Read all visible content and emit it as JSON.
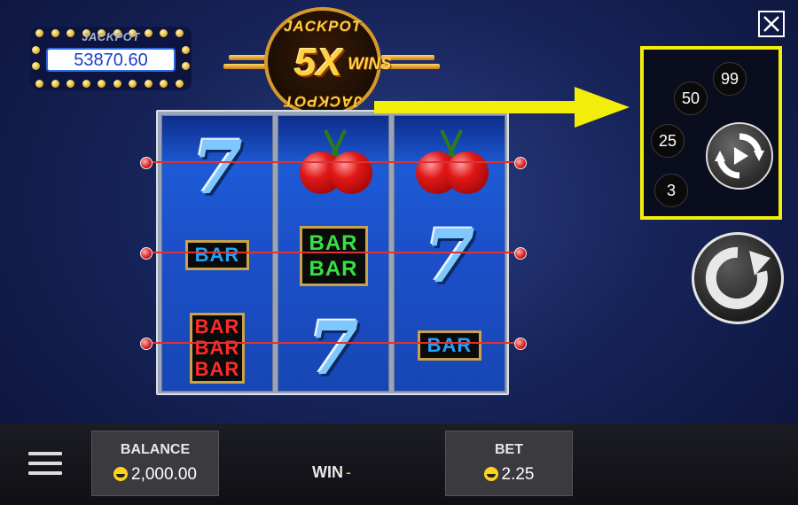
{
  "jackpot": {
    "title": "JACKPOT",
    "value": "53870.60"
  },
  "logo": {
    "top_text": "JACKPOT",
    "bottom_text": "JACKPOT",
    "multiplier": "5X",
    "suffix": "WINS"
  },
  "reels": [
    [
      "seven",
      "bar-blue",
      "bar-red-triple"
    ],
    [
      "cherry",
      "bar-green-double",
      "seven"
    ],
    [
      "cherry",
      "seven",
      "bar-blue"
    ]
  ],
  "symbols": {
    "bar": "BAR",
    "seven": "7"
  },
  "autoplay": {
    "options": [
      "99",
      "50",
      "25",
      "3"
    ],
    "icon": "autoplay-icon"
  },
  "close_icon": "close-icon",
  "spin_icon": "spin-icon",
  "bottom": {
    "balance_label": "BALANCE",
    "balance_value": "2,000.00",
    "win_label": "WIN",
    "win_value": "-",
    "bet_label": "BET",
    "bet_value": "2.25"
  },
  "colors": {
    "highlight": "#f2ee0a",
    "payline": "#dd3333",
    "jackpot_text": "#1a3fc8",
    "coin": "#ffd21f"
  }
}
